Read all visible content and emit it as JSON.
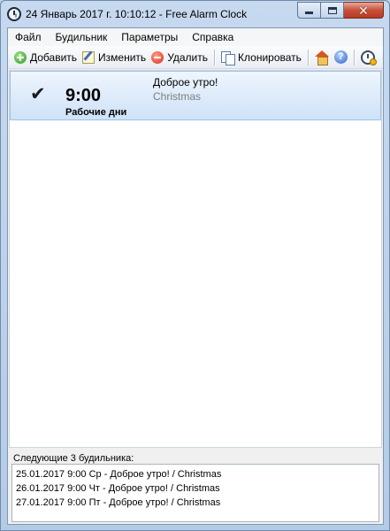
{
  "window": {
    "title": "24 Январь 2017 г. 10:10:12 - Free Alarm Clock"
  },
  "menu": [
    {
      "label": "Файл"
    },
    {
      "label": "Будильник"
    },
    {
      "label": "Параметры"
    },
    {
      "label": "Справка"
    }
  ],
  "toolbar": {
    "add_label": "Добавить",
    "edit_label": "Изменить",
    "delete_label": "Удалить",
    "clone_label": "Клонировать",
    "help_glyph": "?"
  },
  "alarms": [
    {
      "enabled_glyph": "✔",
      "time": "9:00",
      "days": "Рабочие дни",
      "message": "Доброе утро!",
      "sound": "Christmas"
    }
  ],
  "upcoming": {
    "label": "Следующие 3 будильника:",
    "items": [
      "25.01.2017 9:00 Ср - Доброе утро! / Christmas",
      "26.01.2017 9:00 Чт - Доброе утро! / Christmas",
      "27.01.2017 9:00 Пт - Доброе утро! / Christmas"
    ]
  },
  "colors": {
    "selection_top": "#eef5fd",
    "selection_bottom": "#cfe2f8",
    "close_button": "#c7503a"
  }
}
